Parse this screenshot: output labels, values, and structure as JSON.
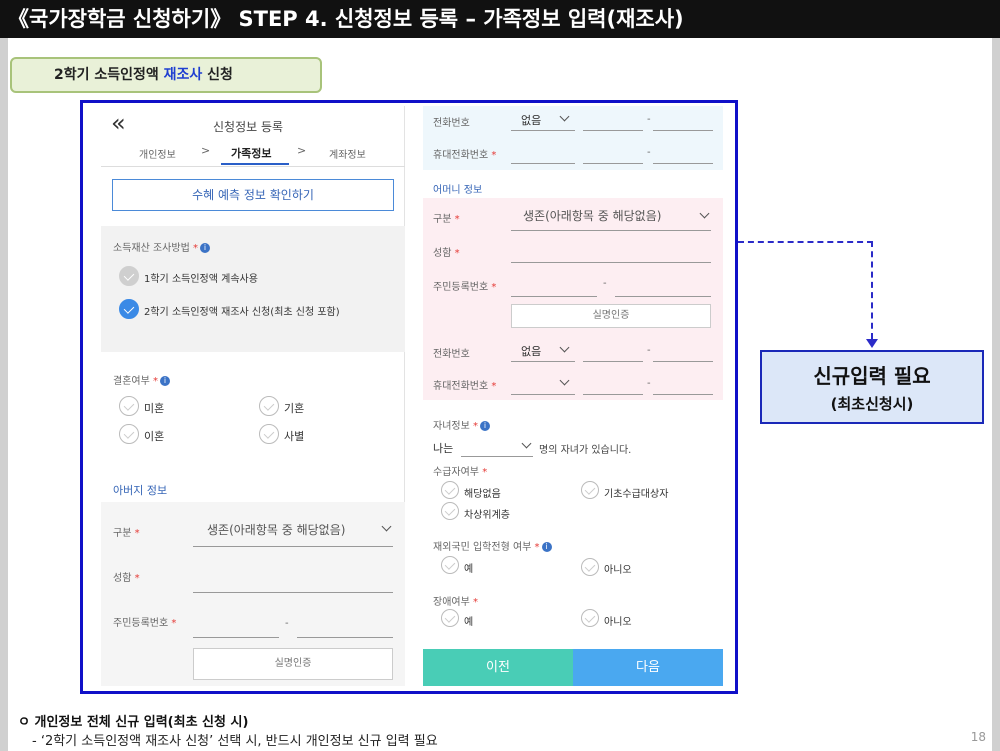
{
  "header": {
    "title": "《국가장학금 신청하기》 STEP 4. 신청정보 등록 – 가족정보 입력(재조사)"
  },
  "tag": {
    "prefix": "2학기 소득인정액 ",
    "highlight": "재조사",
    "suffix": " 신청"
  },
  "left": {
    "back_glyph": "«",
    "title": "신청정보 등록",
    "steps": [
      "개인정보",
      "가족정보",
      "계좌정보"
    ],
    "step_sep": ">",
    "benefit_btn": "수혜 예측 정보 확인하기",
    "survey_label": "소득재산 조사방법",
    "survey_options": [
      "1학기 소득인정액 계속사용",
      "2학기 소득인정액 재조사 신청(최초 신청 포함)"
    ],
    "marriage_label": "결혼여부",
    "marriage_options": [
      "미혼",
      "기혼",
      "이혼",
      "사별"
    ],
    "father_title": "아버지 정보",
    "father_type_label": "구분",
    "father_type_value": "생존(아래항목 중 해당없음)",
    "father_name_label": "성함",
    "father_rrn_label": "주민등록번호",
    "dash": "-",
    "verify_btn": "실명인증"
  },
  "right": {
    "phone_label": "전화번호",
    "phone_value": "없음",
    "mobile_label": "휴대전화번호",
    "dash": "-",
    "mother_title": "어머니 정보",
    "mother_type_label": "구분",
    "mother_type_value": "생존(아래항목 중 해당없음)",
    "mother_name_label": "성함",
    "mother_rrn_label": "주민등록번호",
    "verify_btn": "실명인증",
    "phone2_label": "전화번호",
    "phone2_value": "없음",
    "mobile2_label": "휴대전화번호",
    "children_label": "자녀정보",
    "children_prefix": "나는",
    "children_suffix": "명의 자녀가 있습니다.",
    "recipient_label": "수급자여부",
    "recipient_options": [
      "해당없음",
      "기초수급대상자",
      "차상위계층"
    ],
    "overseas_label": "재외국민 입학전형 여부",
    "overseas_options": [
      "예",
      "아니오"
    ],
    "disabled_label": "장애여부",
    "disabled_options": [
      "예",
      "아니오"
    ],
    "prev_btn": "이전",
    "next_btn": "다음",
    "req_mark": "*"
  },
  "callout": {
    "main": "신규입력 필요",
    "sub": "(최초신청시)"
  },
  "footer": {
    "line1": "ㅇ 개인정보 전체 신규 입력(최초 신청 시)",
    "line2": "- ‘2학기 소득인정액 재조사 신청’ 선택 시, 반드시 개인정보 신규 입력 필요"
  },
  "page_number": "18",
  "colors": {
    "frame": "#1010c8",
    "accent": "#3b8ae6",
    "prev": "#49cdb6",
    "next": "#4aa8f0",
    "callout_bg": "#dce7f8"
  }
}
